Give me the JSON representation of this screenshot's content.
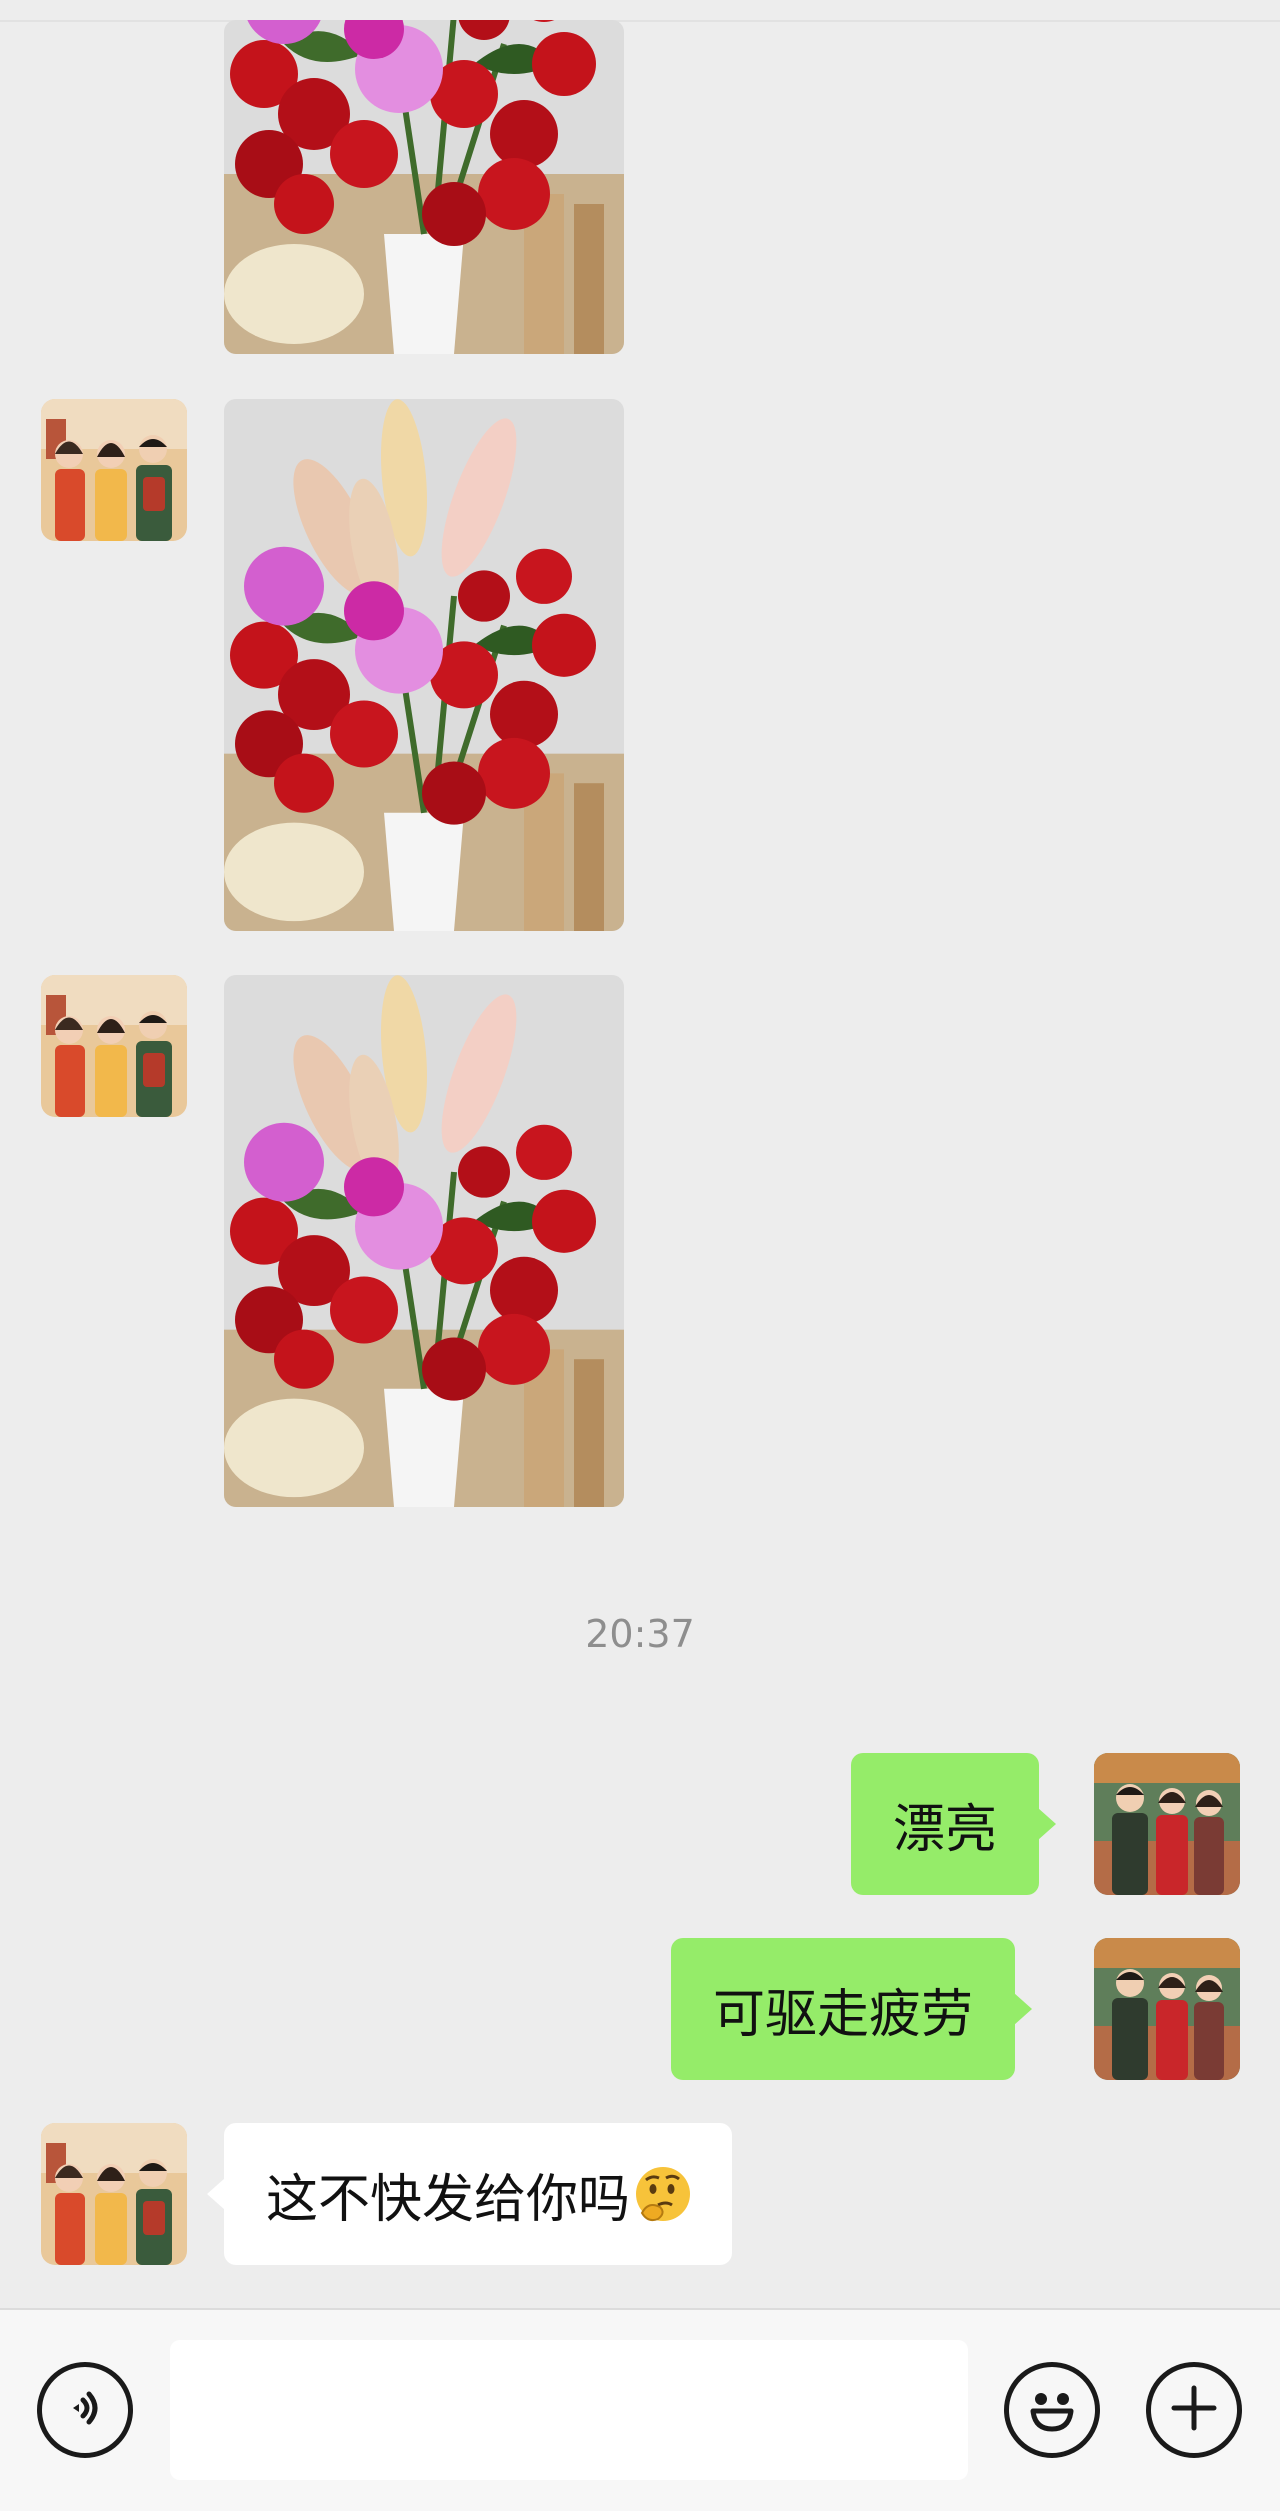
{
  "chat": {
    "timestamp": "20:37",
    "messages": [
      {
        "type": "image",
        "from": "friend",
        "alt": "bouquet photo"
      },
      {
        "type": "image",
        "from": "friend",
        "alt": "bouquet photo"
      },
      {
        "type": "image",
        "from": "friend",
        "alt": "bouquet photo"
      },
      {
        "type": "text",
        "from": "me",
        "text": "漂亮"
      },
      {
        "type": "text",
        "from": "me",
        "text": "可驱走疲劳"
      },
      {
        "type": "text",
        "from": "friend",
        "text": "这不快发给你吗",
        "emoji": "thinking-face"
      }
    ]
  },
  "input_bar": {
    "voice_icon": "voice-icon",
    "emoji_icon": "emoji-icon",
    "plus_icon": "plus-icon",
    "input_value": ""
  },
  "colors": {
    "background": "#ededed",
    "outgoing_bubble": "#95ec69",
    "incoming_bubble": "#ffffff"
  }
}
